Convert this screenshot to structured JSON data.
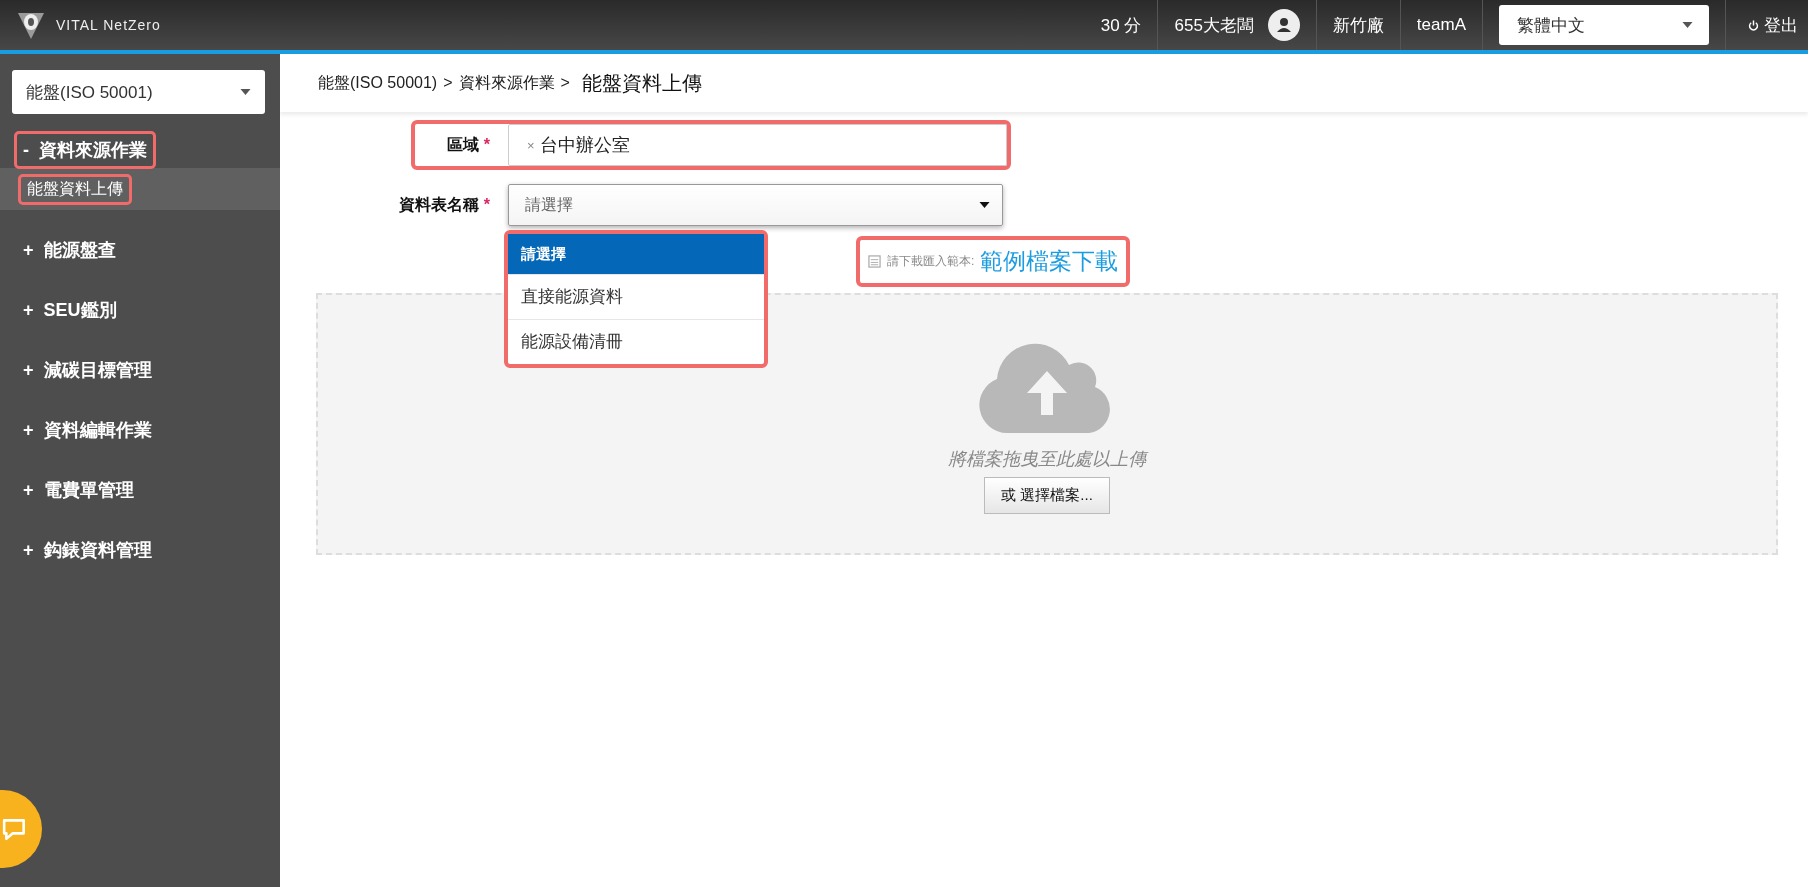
{
  "header": {
    "logo": "VITAL NetZero",
    "points": "30 分",
    "user": "655大老闆",
    "site": "新竹廠",
    "team": "teamA",
    "language": {
      "value": "繁體中文"
    },
    "logout": "登出"
  },
  "sidebar": {
    "module_select": {
      "value": "能盤(ISO 50001)"
    },
    "items": [
      {
        "label": "資料來源作業",
        "highlighted": true,
        "toggle": "-",
        "children": [
          {
            "label": "能盤資料上傳",
            "selected": true,
            "highlighted": true
          }
        ]
      },
      {
        "label": "能源盤查",
        "highlighted": false,
        "toggle": "+"
      },
      {
        "label": "SEU鑑別",
        "highlighted": false,
        "toggle": "+"
      },
      {
        "label": "減碳目標管理",
        "highlighted": false,
        "toggle": "+"
      },
      {
        "label": "資料編輯作業",
        "highlighted": false,
        "toggle": "+"
      },
      {
        "label": "電費單管理",
        "highlighted": false,
        "toggle": "+"
      },
      {
        "label": "鈎錶資料管理",
        "highlighted": false,
        "toggle": "+"
      }
    ]
  },
  "breadcrumb": {
    "path": [
      "能盤(ISO 50001)",
      "資料來源作業"
    ],
    "separator": ">",
    "current": "能盤資料上傳"
  },
  "form": {
    "fields": [
      {
        "kind": "tags",
        "label": "區域",
        "required_mark": "*",
        "highlighted": true,
        "tags": [
          {
            "remove": "×",
            "label": "台中辦公室"
          }
        ]
      },
      {
        "kind": "select",
        "label": "資料表名稱",
        "required_mark": "*",
        "highlighted": false,
        "placeholder": "請選擇",
        "expanded": true,
        "options_highlighted": true,
        "options": [
          {
            "label": "請選擇",
            "selected": true
          },
          {
            "label": "直接能源資料",
            "selected": false
          },
          {
            "label": "能源設備清冊",
            "selected": false
          }
        ]
      }
    ]
  },
  "template": {
    "hint": "請下載匯入範本:",
    "link": "範例檔案下載",
    "highlighted": true
  },
  "upload": {
    "hint": "將檔案拖曳至此處以上傳",
    "button": "或 選擇檔案..."
  }
}
